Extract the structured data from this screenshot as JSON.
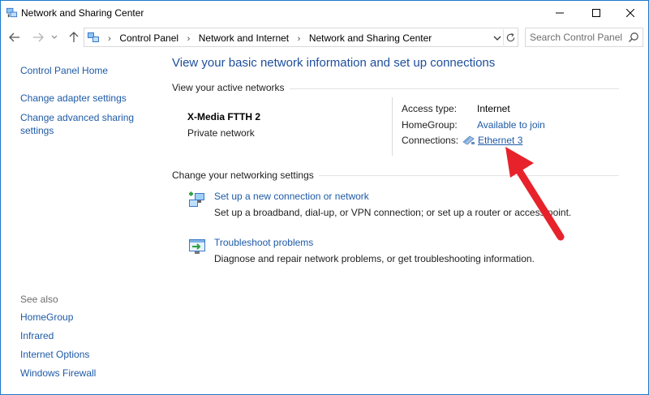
{
  "window": {
    "title": "Network and Sharing Center"
  },
  "address_bar": {
    "breadcrumbs": [
      "Control Panel",
      "Network and Internet",
      "Network and Sharing Center"
    ]
  },
  "search": {
    "placeholder": "Search Control Panel"
  },
  "sidebar": {
    "links": [
      "Control Panel Home",
      "Change adapter settings",
      "Change advanced sharing settings"
    ],
    "see_also_label": "See also",
    "see_also_links": [
      "HomeGroup",
      "Infrared",
      "Internet Options",
      "Windows Firewall"
    ]
  },
  "main": {
    "title": "View your basic network information and set up connections",
    "active_networks_heading": "View your active networks",
    "network": {
      "name": "X-Media FTTH 2",
      "category": "Private network",
      "access_type_label": "Access type:",
      "access_type_value": "Internet",
      "homegroup_label": "HomeGroup:",
      "homegroup_value": "Available to join",
      "connections_label": "Connections:",
      "connections_value": "Ethernet 3"
    },
    "settings_heading": "Change your networking settings",
    "tasks": [
      {
        "link": "Set up a new connection or network",
        "description": "Set up a broadband, dial-up, or VPN connection; or set up a router or access point."
      },
      {
        "link": "Troubleshoot problems",
        "description": "Diagnose and repair network problems, or get troubleshooting information."
      }
    ]
  },
  "colors": {
    "link": "#1e5aa6",
    "title": "#1e4e9b",
    "window_border": "#1979ca",
    "annotation_arrow": "#e8222a"
  }
}
